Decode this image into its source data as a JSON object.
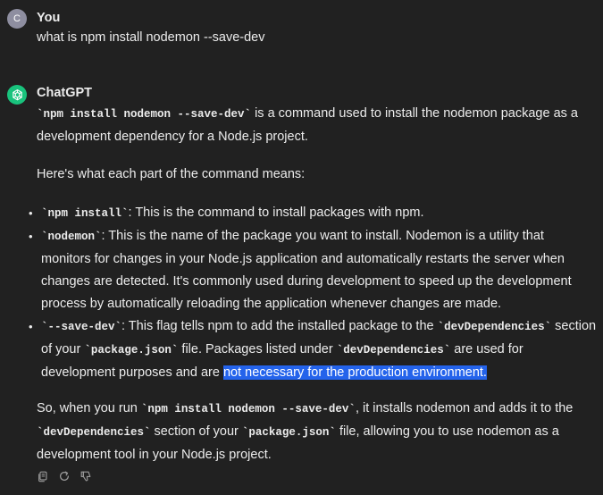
{
  "user_message": {
    "avatar_letter": "C",
    "sender": "You",
    "text": "what is npm install nodemon --save-dev"
  },
  "assistant_message": {
    "sender": "ChatGPT",
    "intro_code": "`npm install nodemon --save-dev`",
    "intro_text": " is a command used to install the nodemon package as a development dependency for a Node.js project.",
    "explain_heading": "Here's what each part of the command means:",
    "bullets": [
      {
        "code": "`npm install`",
        "text": ": This is the command to install packages with npm."
      },
      {
        "code": "`nodemon`",
        "text": ": This is the name of the package you want to install. Nodemon is a utility that monitors for changes in your Node.js application and automatically restarts the server when changes are detected. It's commonly used during development to speed up the development process by automatically reloading the application whenever changes are made."
      },
      {
        "code": "`--save-dev`",
        "text_a": ": This flag tells npm to add the installed package to the ",
        "code_b": "`devDependencies`",
        "text_b": " section of your ",
        "code_c": "`package.json`",
        "text_c": " file. Packages listed under ",
        "code_d": "`devDependencies`",
        "text_d": " are used for development purposes and are ",
        "highlighted": "not necessary for the production environment."
      }
    ],
    "summary": {
      "text_a": "So, when you run ",
      "code_a": "`npm install nodemon --save-dev`",
      "text_b": ", it installs nodemon and adds it to the ",
      "code_b": "`devDependencies`",
      "text_c": " section of your ",
      "code_c": "`package.json`",
      "text_d": " file, allowing you to use nodemon as a development tool in your Node.js project."
    }
  },
  "actions": [
    "copy-icon",
    "regenerate-icon",
    "thumbs-down-icon"
  ],
  "colors": {
    "background": "#212121",
    "text": "#ececec",
    "user_avatar": "#8e8ea0",
    "assistant_avatar": "#19c37d",
    "selection": "#2463eb"
  }
}
